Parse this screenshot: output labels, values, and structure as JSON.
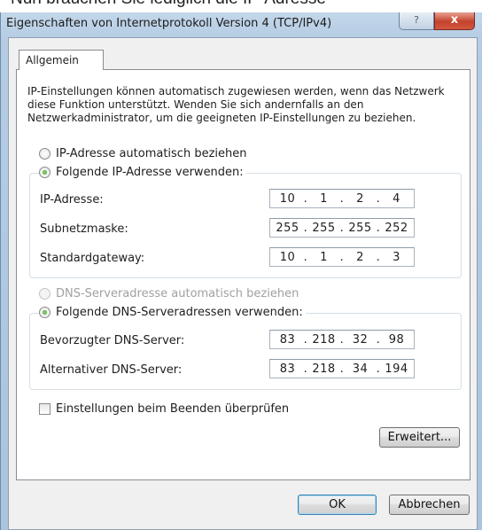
{
  "top_cut_text": "Nun brauchen Sie lediglich die IP-Adresse",
  "window": {
    "title": "Eigenschaften von Internetprotokoll Version 4 (TCP/IPv4)",
    "help_button": "?",
    "close_button": "x"
  },
  "tab": {
    "label": "Allgemein"
  },
  "intro_text": "IP-Einstellungen können automatisch zugewiesen werden, wenn das Netzwerk diese Funktion unterstützt. Wenden Sie sich andernfalls an den Netzwerkadministrator, um die geeigneten IP-Einstellungen zu beziehen.",
  "ip_section": {
    "auto_radio": {
      "label": "IP-Adresse automatisch beziehen",
      "checked": false
    },
    "manual_radio": {
      "label": "Folgende IP-Adresse verwenden:",
      "checked": true
    },
    "ip_address": {
      "label": "IP-Adresse:",
      "octets": [
        "10",
        "1",
        "2",
        "4"
      ]
    },
    "subnet_mask": {
      "label": "Subnetzmaske:",
      "octets": [
        "255",
        "255",
        "255",
        "252"
      ]
    },
    "gateway": {
      "label": "Standardgateway:",
      "octets": [
        "10",
        "1",
        "2",
        "3"
      ]
    }
  },
  "dns_section": {
    "auto_radio": {
      "label": "DNS-Serveradresse automatisch beziehen",
      "checked": false,
      "disabled": true
    },
    "manual_radio": {
      "label": "Folgende DNS-Serveradressen verwenden:",
      "checked": true
    },
    "preferred": {
      "label": "Bevorzugter DNS-Server:",
      "octets": [
        "83",
        "218",
        "32",
        "98"
      ]
    },
    "alternate": {
      "label": "Alternativer DNS-Server:",
      "octets": [
        "83",
        "218",
        "34",
        "194"
      ]
    }
  },
  "validate_checkbox": {
    "label": "Einstellungen beim Beenden überprüfen",
    "checked": false
  },
  "buttons": {
    "advanced": "Erweitert...",
    "ok": "OK",
    "cancel": "Abbrechen"
  },
  "colors": {
    "title_bar": "#b5cce3",
    "close_button": "#c4422c",
    "radio_dot": "#2b8d1a"
  }
}
